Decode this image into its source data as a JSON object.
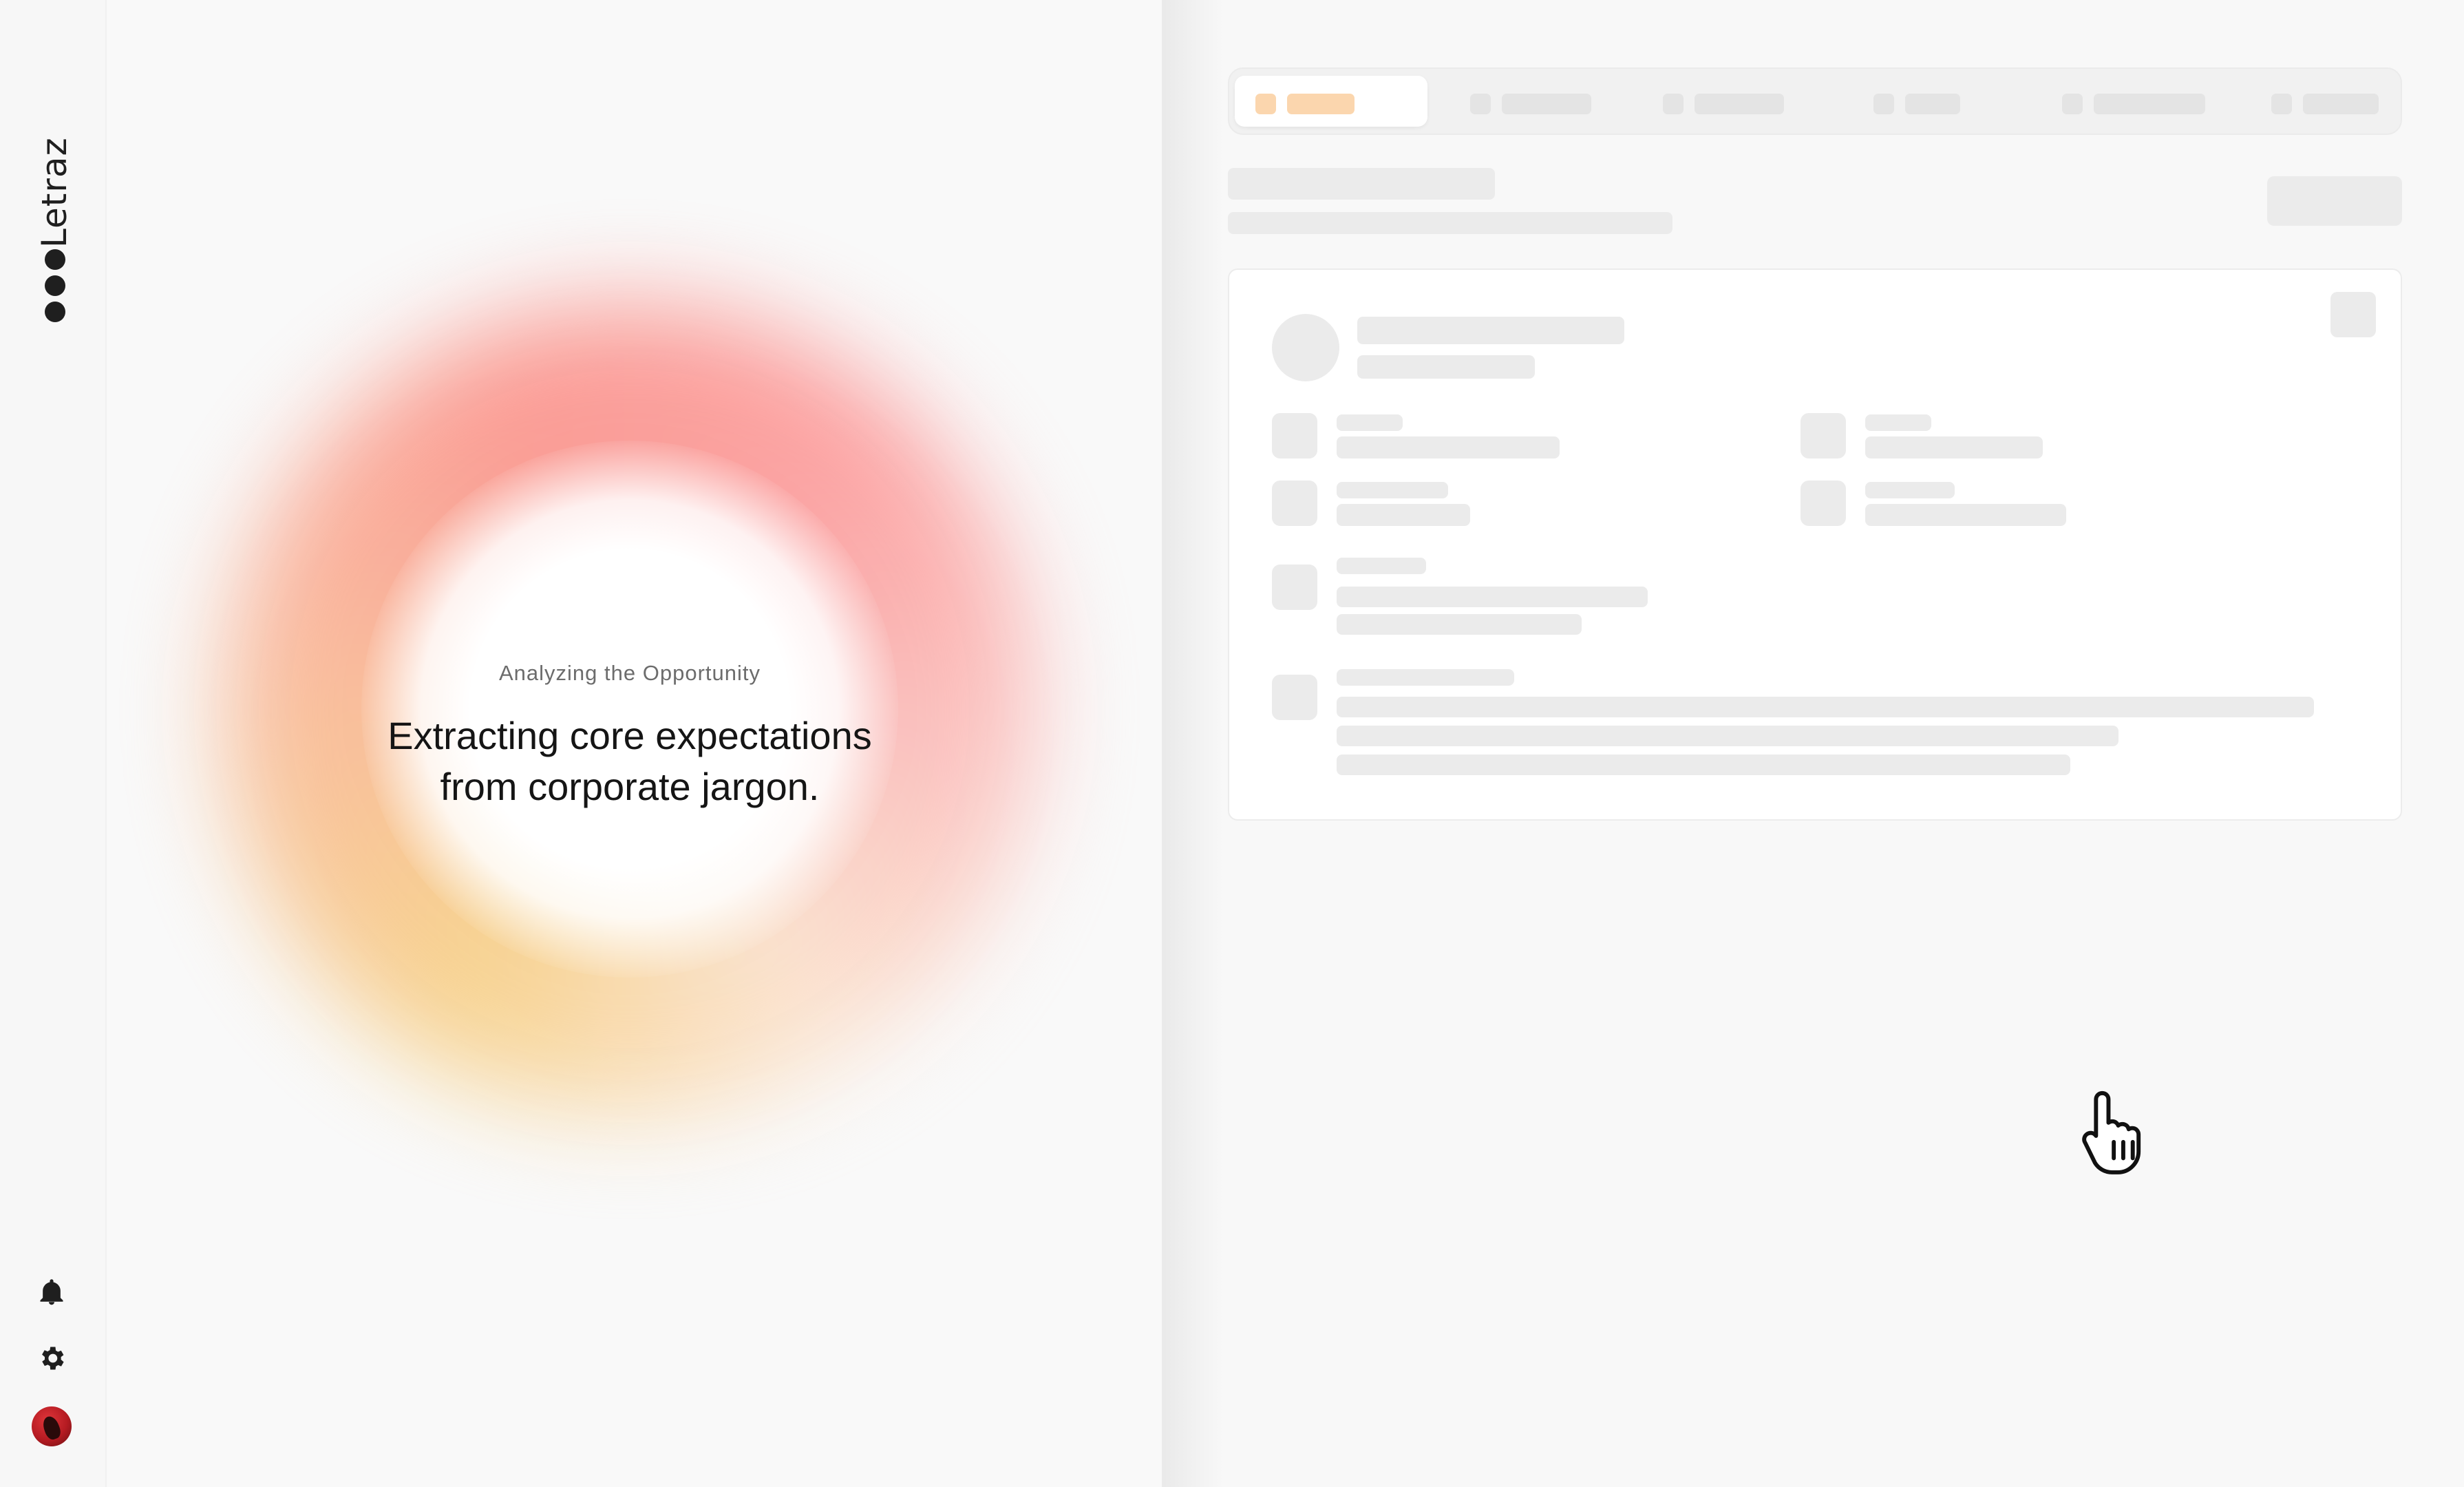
{
  "brand": {
    "name": "Letraz"
  },
  "analysis": {
    "kicker": "Analyzing the Opportunity",
    "headline": "Extracting core expectations from corporate jargon."
  },
  "rail": {
    "icons": [
      "bell-icon",
      "gear-icon",
      "avatar"
    ]
  },
  "colors": {
    "accent_skeleton": "#fbd6ae",
    "skeleton": "#ebebeb",
    "halo_warm": "#f7d28c",
    "halo_red": "#fb9890",
    "ink": "#151515"
  },
  "workspace": {
    "state": "loading",
    "tabs_count": 6
  }
}
